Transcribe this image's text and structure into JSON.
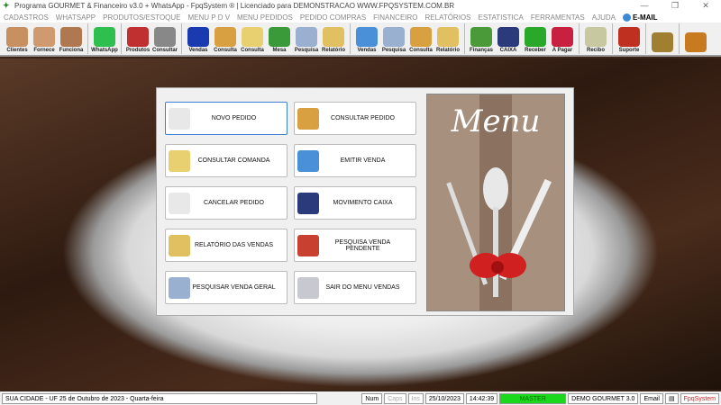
{
  "window": {
    "title": "Programa GOURMET & Financeiro v3.0 + WhatsApp - FpqSystem ® | Licenciado para  DEMONSTRACAO WWW.FPQSYSTEM.COM.BR",
    "minimize": "—",
    "maximize": "❐",
    "close": "✕"
  },
  "menu": [
    "CADASTROS",
    "WHATSAPP",
    "PRODUTOS/ESTOQUE",
    "MENU P D V",
    "MENU PEDIDOS",
    "PEDIDO COMPRAS",
    "FINANCEIRO",
    "RELATÓRIOS",
    "ESTATISTICA",
    "FERRAMENTAS",
    "AJUDA"
  ],
  "menu_email": "E-MAIL",
  "toolbar": [
    {
      "label": "Clientes",
      "color": "#c89060"
    },
    {
      "label": "Fornece",
      "color": "#d09a70"
    },
    {
      "label": "Funciona",
      "color": "#b07850"
    },
    {
      "label": "WhatsApp",
      "color": "#2fbf4f"
    },
    {
      "label": "Produtos",
      "color": "#c03030"
    },
    {
      "label": "Consultar",
      "color": "#888888"
    },
    {
      "label": "Vendas",
      "color": "#1a3ab0"
    },
    {
      "label": "Consulta",
      "color": "#d8a040"
    },
    {
      "label": "Consulta",
      "color": "#e8d070"
    },
    {
      "label": "Mesa",
      "color": "#3a9a3a"
    },
    {
      "label": "Pesquisa",
      "color": "#9ab0d0"
    },
    {
      "label": "Relatório",
      "color": "#e0c060"
    },
    {
      "label": "Vendas",
      "color": "#4a90d8"
    },
    {
      "label": "Pesquisa",
      "color": "#9ab0d0"
    },
    {
      "label": "Consulta",
      "color": "#d8a040"
    },
    {
      "label": "Relatório",
      "color": "#e0c060"
    },
    {
      "label": "Finanças",
      "color": "#4a9a3a"
    },
    {
      "label": "CAIXA",
      "color": "#2a3a7a"
    },
    {
      "label": "Receber",
      "color": "#2aa82a"
    },
    {
      "label": "A Pagar",
      "color": "#c82040"
    },
    {
      "label": "Recibo",
      "color": "#c8c8a0"
    },
    {
      "label": "Suporte",
      "color": "#c03020"
    },
    {
      "label": "",
      "color": "#a08030"
    },
    {
      "label": "",
      "color": "#c87a20"
    }
  ],
  "buttons": [
    {
      "label": "NOVO PEDIDO",
      "color": "#e8e8e8"
    },
    {
      "label": "CONSULTAR PEDIDO",
      "color": "#d8a040"
    },
    {
      "label": "CONSULTAR COMANDA",
      "color": "#e8d070"
    },
    {
      "label": "EMITIR VENDA",
      "color": "#4a90d8"
    },
    {
      "label": "CANCELAR PEDIDO",
      "color": "#e8e8e8"
    },
    {
      "label": "MOVIMENTO CAIXA",
      "color": "#2a3a7a"
    },
    {
      "label": "RELATÓRIO DAS VENDAS",
      "color": "#e0c060"
    },
    {
      "label": "PESQUISA VENDA PENDENTE",
      "color": "#c84030"
    },
    {
      "label": "PESQUISAR VENDA GERAL",
      "color": "#9ab0d0"
    },
    {
      "label": "SAIR DO MENU VENDAS",
      "color": "#c8c8d0"
    }
  ],
  "menu_image_title": "Menu",
  "status": {
    "city": "SUA CIDADE - UF 25 de Outubro de 2023 - Quarta-feira",
    "num": "Num",
    "caps": "Caps",
    "ins": "Ins",
    "date": "25/10/2023",
    "time": "14:42:39",
    "user": "MASTER",
    "company": "DEMO GOURMET 3.0",
    "email": "Email",
    "brand": "FpqSystem"
  }
}
